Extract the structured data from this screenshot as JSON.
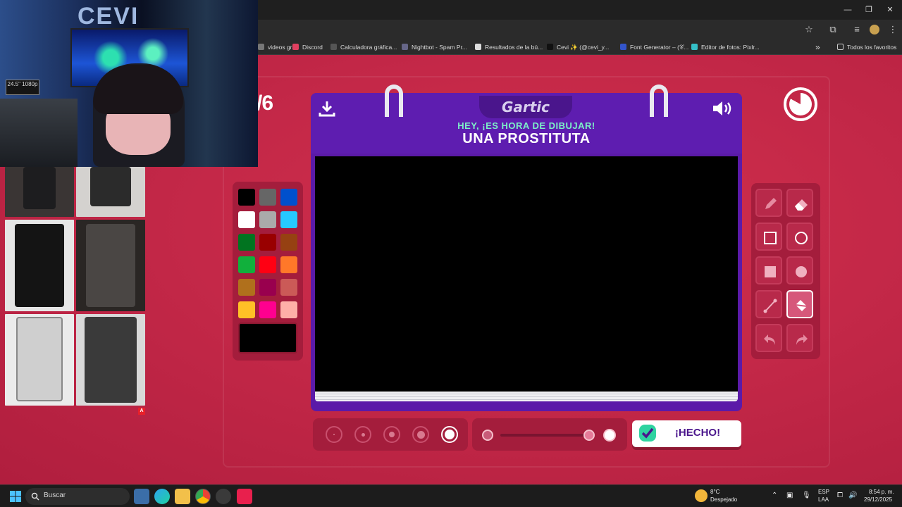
{
  "browser": {
    "window_controls": {
      "minimize": "—",
      "maximize": "❐",
      "close": "✕"
    },
    "bookmarks": [
      {
        "label": "videos gr...",
        "color": "#777777"
      },
      {
        "label": "Discord",
        "color": "#e04060"
      },
      {
        "label": "Calculadora gráfica...",
        "color": "#555555"
      },
      {
        "label": "Nightbot - Spam Pr...",
        "color": "#666688"
      },
      {
        "label": "Resultados de la bú...",
        "color": "#dddddd"
      },
      {
        "label": "Cevi ✨ (@cevi_y...",
        "color": "#111111"
      },
      {
        "label": "Font Generator – (𝒞...",
        "color": "#3355cc"
      },
      {
        "label": "Editor de fotos: Pixlr...",
        "color": "#35c0c8"
      }
    ],
    "bookmarks_more": "»",
    "all_favorites": "Todos los favoritos"
  },
  "game": {
    "round": "/6",
    "logo": "Gartic",
    "hint": "HEY, ¡ES HORA DE DIBUJAR!",
    "word": "UNA PROSTITUTA",
    "done_label": "¡HECHO!",
    "timer_remaining_fraction": 0.83,
    "current_color": "#000000",
    "palette": [
      "#000000",
      "#666666",
      "#0050cd",
      "#ffffff",
      "#aaaaaa",
      "#26c9ff",
      "#017420",
      "#990000",
      "#964112",
      "#11b03c",
      "#ff0013",
      "#ff7829",
      "#b0701c",
      "#99004e",
      "#cb5a57",
      "#ffc126",
      "#ff008f",
      "#feafa8"
    ],
    "tools": [
      {
        "name": "pencil",
        "active": false
      },
      {
        "name": "eraser",
        "active": false
      },
      {
        "name": "rectangle",
        "active": false
      },
      {
        "name": "ellipse",
        "active": false
      },
      {
        "name": "filled-rectangle",
        "active": false
      },
      {
        "name": "filled-ellipse",
        "active": false
      },
      {
        "name": "line",
        "active": false
      },
      {
        "name": "fill-bucket",
        "active": true
      },
      {
        "name": "undo",
        "active": false
      },
      {
        "name": "redo",
        "active": false
      }
    ],
    "brush_sizes": 5,
    "selected_brush_size": 5,
    "opacity_fraction": 1.0
  },
  "taskbar": {
    "search_placeholder": "Buscar",
    "weather_temp": "8°C",
    "weather_desc": "Despejado",
    "lang_top": "ESP",
    "lang_bottom": "LAA",
    "time": "8:54 p. m.",
    "date": "29/12/2025"
  },
  "overlay": {
    "webcam_logo": "CEVI",
    "monitor_label": "24.5\" 1080p",
    "ref_badge": "A"
  }
}
